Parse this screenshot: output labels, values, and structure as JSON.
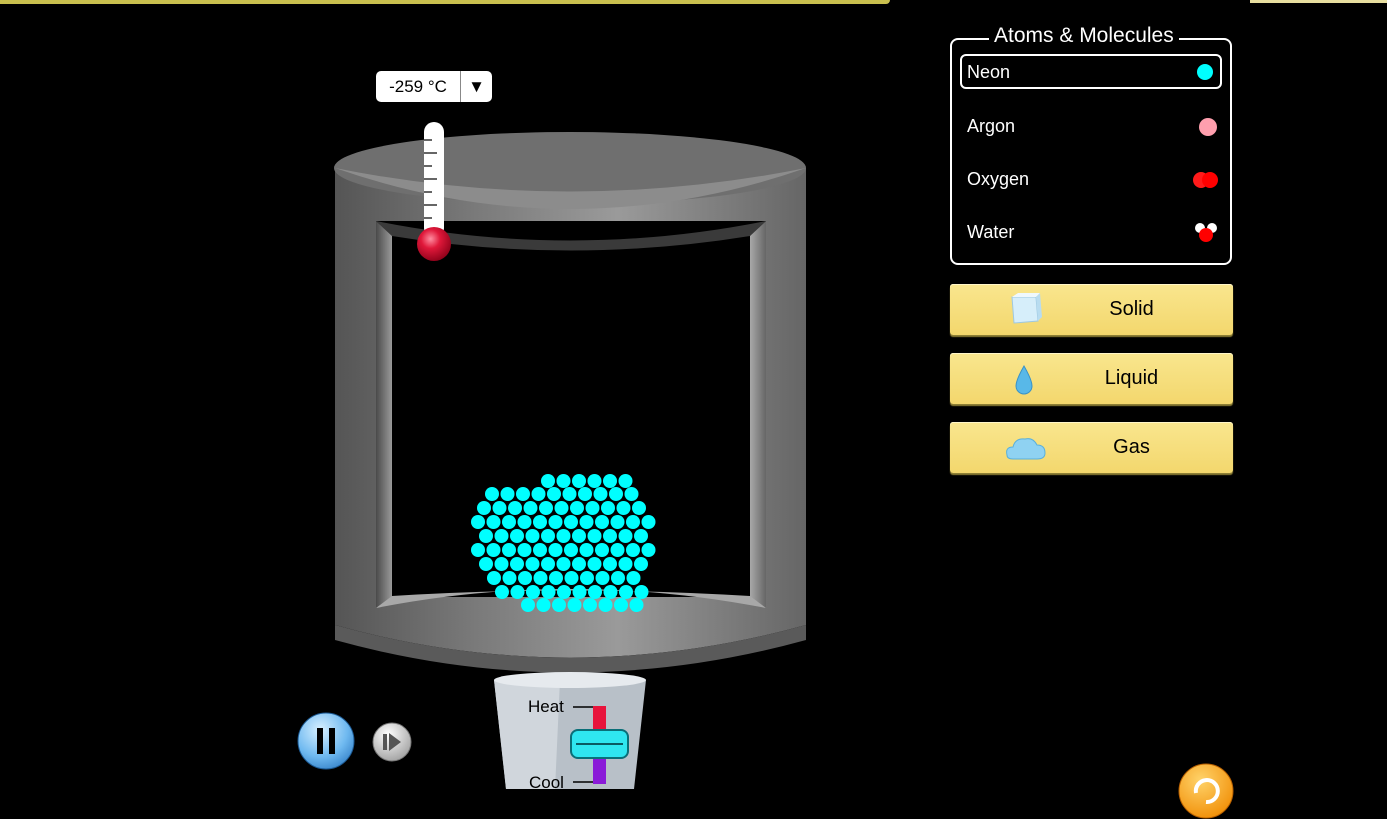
{
  "temperature": {
    "value": "-259 °C",
    "dropdown_arrow": "▼"
  },
  "atoms_panel": {
    "title": "Atoms & Molecules",
    "items": [
      {
        "label": "Neon",
        "selected": true,
        "icon": "neon-atom-icon",
        "color": "#00ffff"
      },
      {
        "label": "Argon",
        "selected": false,
        "icon": "argon-atom-icon",
        "color": "#ff9fae"
      },
      {
        "label": "Oxygen",
        "selected": false,
        "icon": "oxygen-molecule-icon",
        "color": "#ff0000"
      },
      {
        "label": "Water",
        "selected": false,
        "icon": "water-molecule-icon",
        "color": "#ff0000"
      }
    ]
  },
  "phases": {
    "solid": {
      "label": "Solid",
      "icon": "ice-cube-icon"
    },
    "liquid": {
      "label": "Liquid",
      "icon": "water-drop-icon"
    },
    "gas": {
      "label": "Gas",
      "icon": "cloud-icon"
    }
  },
  "heater": {
    "heat_label": "Heat",
    "cool_label": "Cool"
  },
  "colors": {
    "particle": "#00ffff",
    "button_yellow": "#f6df7c",
    "container_gray": "#7a7a7a",
    "background": "#000000"
  }
}
